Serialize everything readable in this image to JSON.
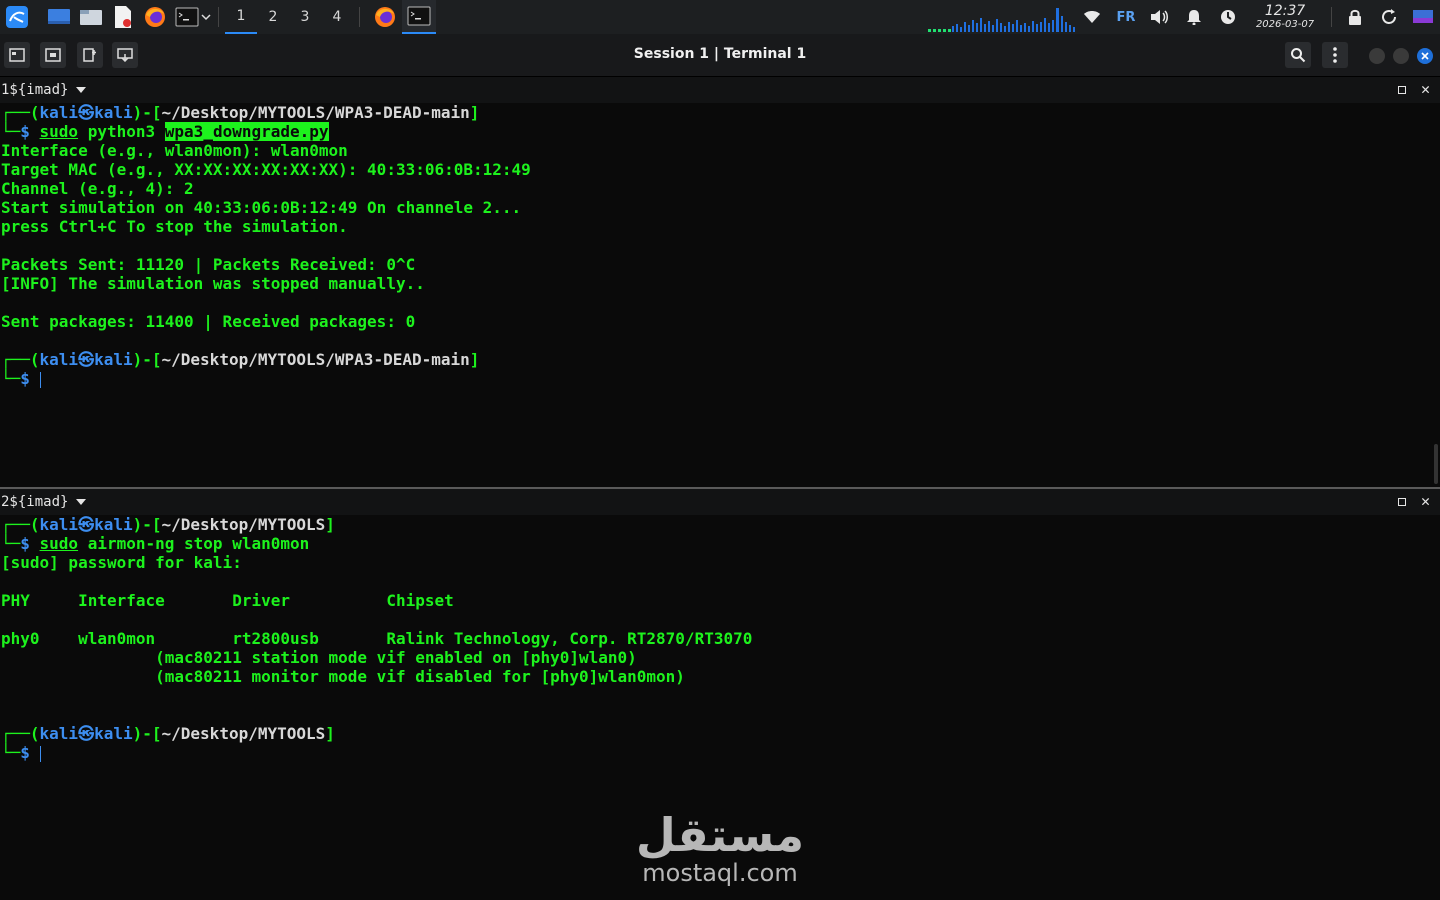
{
  "panel": {
    "workspaces": [
      "1",
      "2",
      "3",
      "4"
    ],
    "active_workspace": "1",
    "keyboard_layout": "FR",
    "clock_time": "12:37",
    "clock_date": "2026-03-07",
    "icons": [
      "kali-menu-icon",
      "show-desktop-icon",
      "file-manager-icon",
      "text-editor-icon",
      "firefox-icon",
      "terminal-icon",
      "chevron-down-icon",
      "firefox-icon",
      "terminal-icon",
      "network-graph",
      "wifi-icon",
      "volume-icon",
      "notification-bell-icon",
      "power-icon",
      "lock-icon",
      "refresh-icon",
      "display-icon"
    ]
  },
  "window": {
    "title": "Session 1 | Terminal 1",
    "toolbar_icons": [
      "new-tab-icon",
      "split-icon",
      "new-window-icon",
      "detach-icon"
    ],
    "search_icon": "search-icon",
    "menu_icon": "kebab-menu-icon",
    "controls": {
      "minimize": "#3a3a3a",
      "maximize": "#3a3a3a",
      "close": "#1e6fd9"
    }
  },
  "pane1": {
    "header": "1${imad}",
    "lines": [
      {
        "type": "prompt",
        "user": "kali",
        "host": "kali",
        "path": "~/Desktop/MYTOOLS/WPA3-DEAD-main"
      },
      {
        "type": "cmd",
        "sudo": "sudo",
        "cmd": "python3",
        "arg": "wpa3_downgrade.py"
      },
      {
        "type": "out",
        "text": "Interface (e.g., wlan0mon): wlan0mon"
      },
      {
        "type": "out",
        "text": "Target MAC (e.g., XX:XX:XX:XX:XX:XX): 40:33:06:0B:12:49"
      },
      {
        "type": "out",
        "text": "Channel (e.g., 4): 2"
      },
      {
        "type": "out",
        "text": "Start simulation on 40:33:06:0B:12:49 On channele 2..."
      },
      {
        "type": "out",
        "text": "press Ctrl+C To stop the simulation."
      },
      {
        "type": "out",
        "text": ""
      },
      {
        "type": "out",
        "text": "Packets Sent: 11120 | Packets Received: 0^C"
      },
      {
        "type": "out",
        "text": "[INFO] The simulation was stopped manually.."
      },
      {
        "type": "out",
        "text": ""
      },
      {
        "type": "out",
        "text": "Sent packages: 11400 | Received packages: 0"
      },
      {
        "type": "out",
        "text": ""
      },
      {
        "type": "prompt",
        "user": "kali",
        "host": "kali",
        "path": "~/Desktop/MYTOOLS/WPA3-DEAD-main"
      },
      {
        "type": "cursor"
      }
    ]
  },
  "pane2": {
    "header": "2${imad}",
    "lines": [
      {
        "type": "prompt",
        "user": "kali",
        "host": "kali",
        "path": "~/Desktop/MYTOOLS"
      },
      {
        "type": "cmd",
        "sudo": "sudo",
        "cmd": "airmon-ng stop wlan0mon",
        "arg": ""
      },
      {
        "type": "out",
        "text": "[sudo] password for kali:"
      },
      {
        "type": "out",
        "text": ""
      },
      {
        "type": "out",
        "text": "PHY     Interface       Driver          Chipset"
      },
      {
        "type": "out",
        "text": ""
      },
      {
        "type": "out",
        "text": "phy0    wlan0mon        rt2800usb       Ralink Technology, Corp. RT2870/RT3070"
      },
      {
        "type": "out",
        "text": "                (mac80211 station mode vif enabled on [phy0]wlan0)"
      },
      {
        "type": "out",
        "text": "                (mac80211 monitor mode vif disabled for [phy0]wlan0mon)"
      },
      {
        "type": "out",
        "text": ""
      },
      {
        "type": "out",
        "text": ""
      },
      {
        "type": "prompt",
        "user": "kali",
        "host": "kali",
        "path": "~/Desktop/MYTOOLS"
      },
      {
        "type": "cursor"
      }
    ]
  },
  "watermark": {
    "arabic": "مستقل",
    "latin": "mostaql.com"
  },
  "colors": {
    "green": "#1df21d",
    "blue": "#3d8ef0",
    "background": "#0a0a0a",
    "panel": "#1d1f21"
  }
}
